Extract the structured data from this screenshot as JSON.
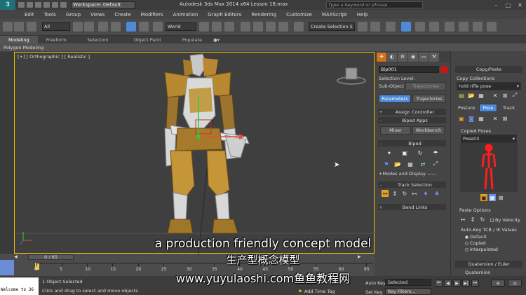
{
  "titlebar": {
    "logo": "3",
    "workspace": "Workspace: Default",
    "title": "Autodesk 3ds Max  2014 x64       Lesson 18.max",
    "search_placeholder": "Type a keyword or phrase"
  },
  "menu": [
    "Edit",
    "Tools",
    "Group",
    "Views",
    "Create",
    "Modifiers",
    "Animation",
    "Graph Editors",
    "Rendering",
    "Customize",
    "MAXScript",
    "Help"
  ],
  "toolbar": {
    "filter": "All",
    "refcoord": "World",
    "selection_set": "Create Selection S"
  },
  "ribbon": {
    "tabs": [
      "Modeling",
      "Freeform",
      "Selection",
      "Object Paint",
      "Populate"
    ],
    "active": "Modeling",
    "sub_label": "Polygon Modeling"
  },
  "viewport": {
    "label": "[+] [ Orthographic ] [ Realistic ]"
  },
  "command_panel": {
    "object_name": "Bip001",
    "object_color": "#d41010",
    "selection_level": "Selection Level:",
    "sub_object": "Sub-Object",
    "trajectories_field": "Trajectories",
    "parameters_btn": "Parameters",
    "trajectories_btn": "Trajectories",
    "assign_controller": "Assign Controller",
    "biped_apps": "Biped Apps",
    "mixer": "Mixer",
    "workbench": "Workbench",
    "biped": "Biped",
    "modes_display": "Modes and Display",
    "track_selection": "Track Selection",
    "bend_links": "Bend Links"
  },
  "right_panel": {
    "copy_paste": "Copy/Paste",
    "copy_collections": "Copy Collections",
    "collection_value": "hold rifle pose",
    "posture": "Posture",
    "pose": "Pose",
    "track": "Track",
    "copied_poses": "Copied Poses",
    "pose_value": "Pose03",
    "paste_options": "Paste Options",
    "by_velocity": "By Velocity",
    "auto_key": "Auto-Key TCB / IK Values",
    "options": [
      "Default",
      "Copied",
      "Interpolated"
    ],
    "selected_option": "Default",
    "quaternion": "Quaternion / Euler",
    "quaternion_item": "Quaternion"
  },
  "timeline": {
    "slider": "0 / 65",
    "ticks": [
      "0",
      "5",
      "10",
      "15",
      "20",
      "25",
      "30",
      "35",
      "40",
      "45",
      "50",
      "55",
      "60",
      "65"
    ]
  },
  "status": {
    "maxscript": "Welcome to 36",
    "objects_selected": "1 Object Selected",
    "prompt": "Click and drag to select and move objects",
    "add_time_tag": "Add Time Tag",
    "auto_key": "Auto Key",
    "selected": "Selected",
    "set_key": "Set Key",
    "key_filters": "Key Filters..."
  },
  "subtitles": {
    "line1": "a production friendly concept model",
    "line2": "生产型概念模型",
    "line3": "www.yuyulaoshi.com鱼鱼教程网"
  }
}
